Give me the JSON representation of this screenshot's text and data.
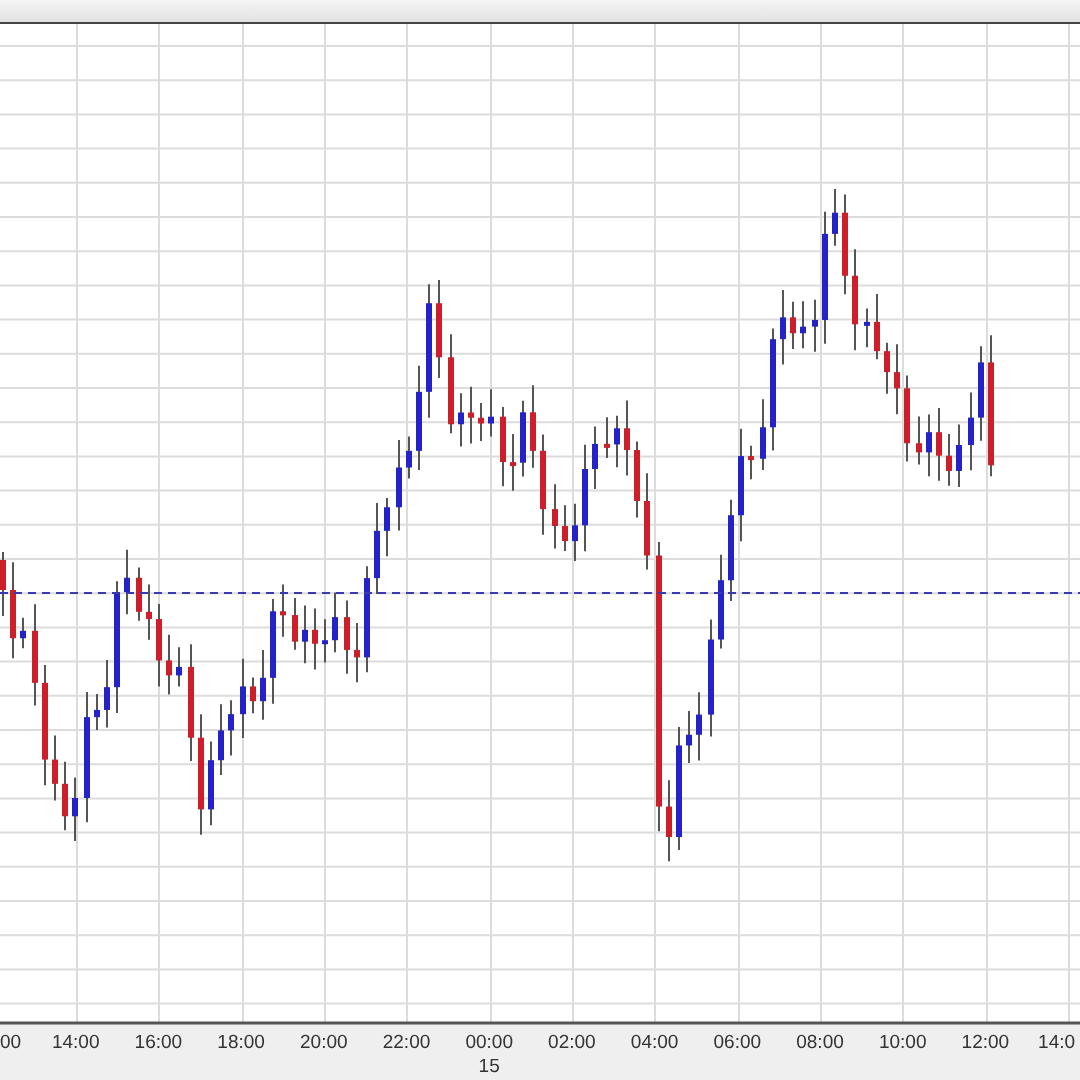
{
  "chart": {
    "x_labels": [
      {
        "label": "00"
      },
      {
        "label": "14:00"
      },
      {
        "label": "16:00"
      },
      {
        "label": "18:00"
      },
      {
        "label": "20:00"
      },
      {
        "label": "22:00"
      },
      {
        "label": "00:00",
        "date": "15"
      },
      {
        "label": "02:00"
      },
      {
        "label": "04:00"
      },
      {
        "label": "06:00"
      },
      {
        "label": "08:00"
      },
      {
        "label": "10:00"
      },
      {
        "label": "12:00"
      },
      {
        "label": "14:0"
      }
    ]
  }
}
